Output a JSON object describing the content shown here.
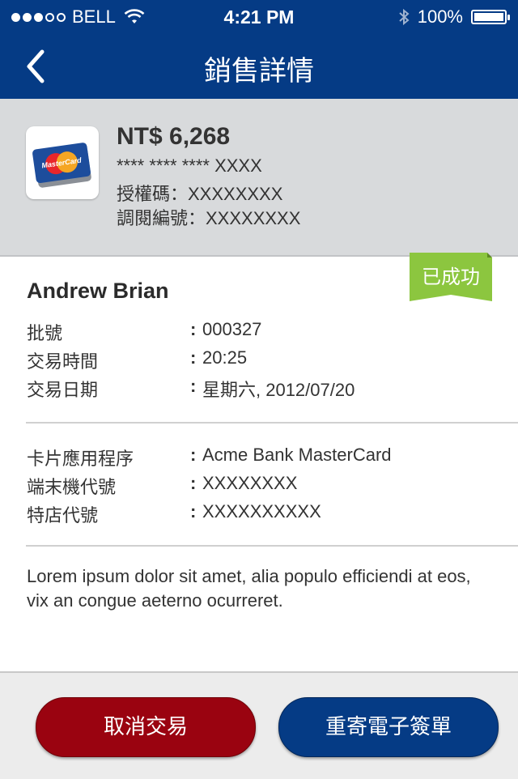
{
  "status_bar": {
    "carrier": "BELL",
    "time": "4:21 PM",
    "battery": "100%"
  },
  "nav": {
    "title": "銷售詳情"
  },
  "summary": {
    "amount": "NT$ 6,268",
    "card_number": "**** **** **** XXXX",
    "auth_code": "授權碼：XXXXXXXX",
    "ref_number": "調閱編號：XXXXXXXX",
    "card_logo_text": "MasterCard"
  },
  "status_badge": "已成功",
  "customer_name": "Andrew Brian",
  "details_1": [
    {
      "label": "批號",
      "value": "000327"
    },
    {
      "label": "交易時間",
      "value": "20:25"
    },
    {
      "label": "交易日期",
      "value": "星期六, 2012/07/20"
    }
  ],
  "details_2": [
    {
      "label": "卡片應用程序",
      "value": "Acme Bank MasterCard"
    },
    {
      "label": "端末機代號",
      "value": "XXXXXXXX"
    },
    {
      "label": "特店代號",
      "value": "XXXXXXXXXX"
    }
  ],
  "separator": ":",
  "description": "Lorem ipsum dolor sit amet, alia populo efficiendi at eos, vix an congue aeterno ocurreret.",
  "buttons": {
    "cancel": "取消交易",
    "resend": "重寄電子簽單"
  },
  "colors": {
    "nav_blue": "#053b85",
    "cancel_red": "#9a0310",
    "success_green": "#8cc63f"
  }
}
